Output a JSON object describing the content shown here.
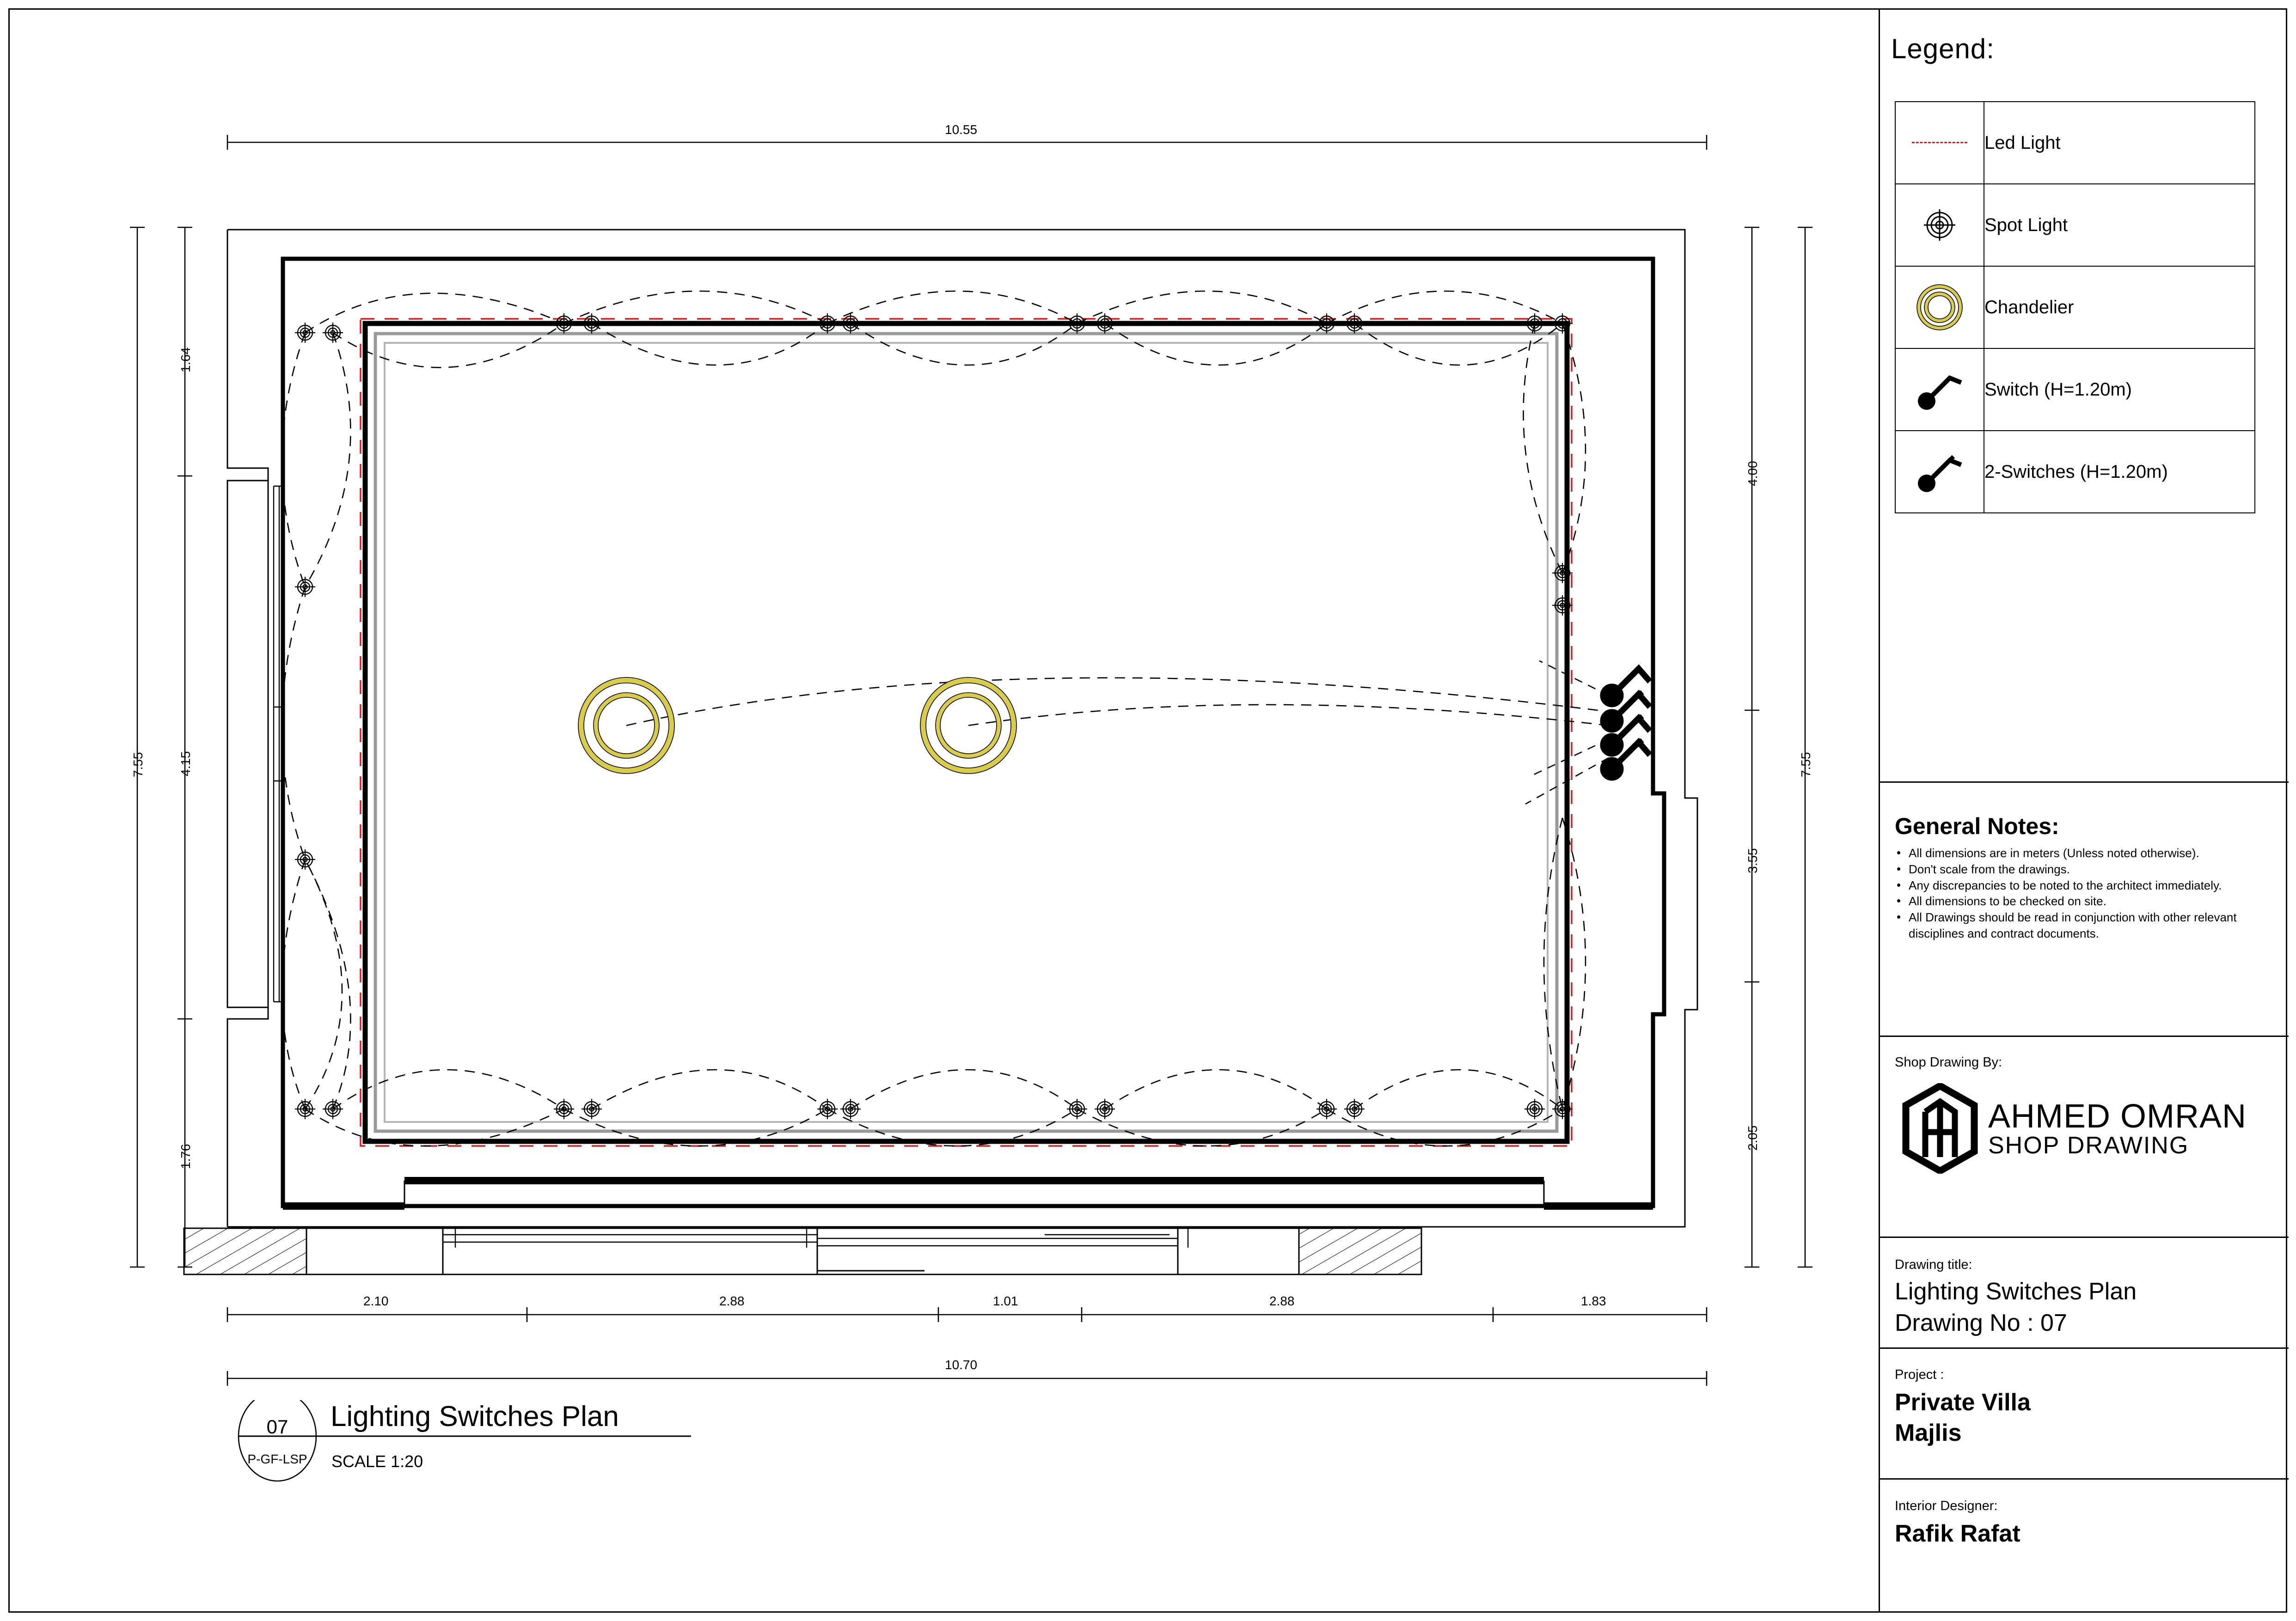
{
  "sheet": {
    "legend": {
      "title": "Legend:",
      "items": [
        {
          "symbol": "led-light-dashed-line",
          "label": "Led Light"
        },
        {
          "symbol": "spot-light-concentric-circles",
          "label": "Spot Light"
        },
        {
          "symbol": "chandelier-double-ring",
          "label": "Chandelier"
        },
        {
          "symbol": "switch-single",
          "label": "Switch (H=1.20m)"
        },
        {
          "symbol": "switch-double",
          "label": "2-Switches (H=1.20m)"
        }
      ]
    },
    "general_notes": {
      "title": "General Notes:",
      "items": [
        "All dimensions are in meters (Unless noted otherwise).",
        "Don't scale from the drawings.",
        "Any discrepancies to be noted to the architect immediately.",
        "All dimensions to be checked on site.",
        "All Drawings should be read in conjunction with other relevant disciplines and contract documents."
      ]
    },
    "shop_drawing_by": {
      "label": "Shop Drawing By:",
      "company_name": "AHMED OMRAN",
      "company_sub": "SHOP DRAWING"
    },
    "drawing_title": {
      "label": "Drawing title:",
      "line1": "Lighting Switches Plan",
      "line2": "Drawing No : 07"
    },
    "project": {
      "label": "Project :",
      "line1": "Private Villa",
      "line2": "Majlis"
    },
    "interior_designer": {
      "label": "Interior Designer:",
      "name": "Rafik Rafat"
    }
  },
  "title_tag": {
    "number": "07",
    "code": "P-GF-LSP",
    "title": "Lighting Switches Plan",
    "scale": "SCALE 1:20"
  },
  "plan": {
    "dimensions": {
      "top_overall": "10.55",
      "bottom_overall": "10.70",
      "bottom_segments": [
        "2.10",
        "2.88",
        "1.01",
        "2.88",
        "1.83"
      ],
      "left_overall": "7.55",
      "left_segments": [
        "1.64",
        "4.15",
        "1.76"
      ],
      "right_overall": "7.55",
      "right_segments": [
        "4.00",
        "3.55",
        "2.05"
      ]
    },
    "fixture_counts": {
      "chandeliers": 2,
      "switch_single": 1,
      "switch_double": 3
    },
    "colors": {
      "led_line": "#d22020",
      "chandelier_ring": "#d8cc4a",
      "ceiling_frame": "#8a8a8a",
      "wall_line": "#000000"
    }
  }
}
